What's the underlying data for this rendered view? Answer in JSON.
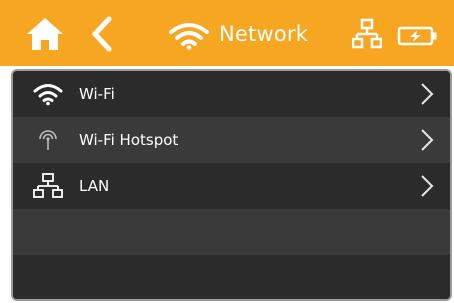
{
  "header": {
    "title": "Network",
    "background_color": "#f7a622",
    "icons": [
      "home-icon",
      "back-icon",
      "wifi-icon",
      "lan-icon",
      "battery-icon"
    ]
  },
  "menu": {
    "items": [
      {
        "label": "Wi-Fi",
        "icon": "wifi-icon"
      },
      {
        "label": "Wi-Fi Hotspot",
        "icon": "hotspot-icon"
      },
      {
        "label": "LAN",
        "icon": "lan-icon"
      }
    ],
    "colors": {
      "row_dark": "#2b2b2b",
      "row_light": "#3a3a3a",
      "border": "#9b9b9b"
    }
  }
}
